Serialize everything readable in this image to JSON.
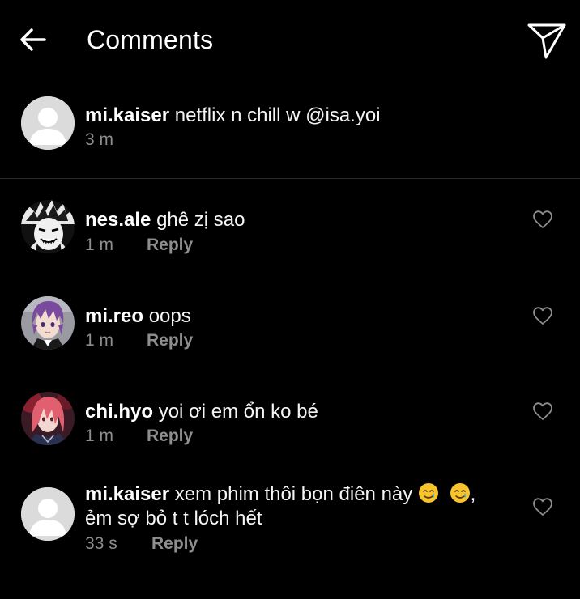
{
  "header": {
    "back_icon": "arrow-left-icon",
    "title": "Comments",
    "send_icon": "paper-plane-icon"
  },
  "caption": {
    "username": "mi.kaiser",
    "text": "netflix n chill w @isa.yoi",
    "time": "3 m"
  },
  "comments": [
    {
      "username": "nes.ale",
      "text": "ghê zị sao",
      "time": "1 m",
      "reply_label": "Reply",
      "avatar": "manga-avatar"
    },
    {
      "username": "mi.reo",
      "text": "oops",
      "time": "1 m",
      "reply_label": "Reply",
      "avatar": "purple-hair-avatar"
    },
    {
      "username": "chi.hyo",
      "text": "yoi ơi em ổn ko bé",
      "time": "1 m",
      "reply_label": "Reply",
      "avatar": "pink-hair-avatar"
    },
    {
      "username": "mi.kaiser",
      "text_line1": "xem phim thôi bọn điên này",
      "text_line1_suffix": ",",
      "text_line2": "ẻm sợ bỏ t t lóch hết",
      "emojis": [
        "smiling-face-with-tear",
        "smiling-face-with-tear"
      ],
      "time": "33 s",
      "reply_label": "Reply",
      "avatar": "default-avatar"
    }
  ],
  "colors": {
    "background": "#000000",
    "text": "#f5f5f5",
    "secondary": "#8e8e8e",
    "divider": "#2a2a2a",
    "placeholder_avatar": "#dbdbdb"
  }
}
